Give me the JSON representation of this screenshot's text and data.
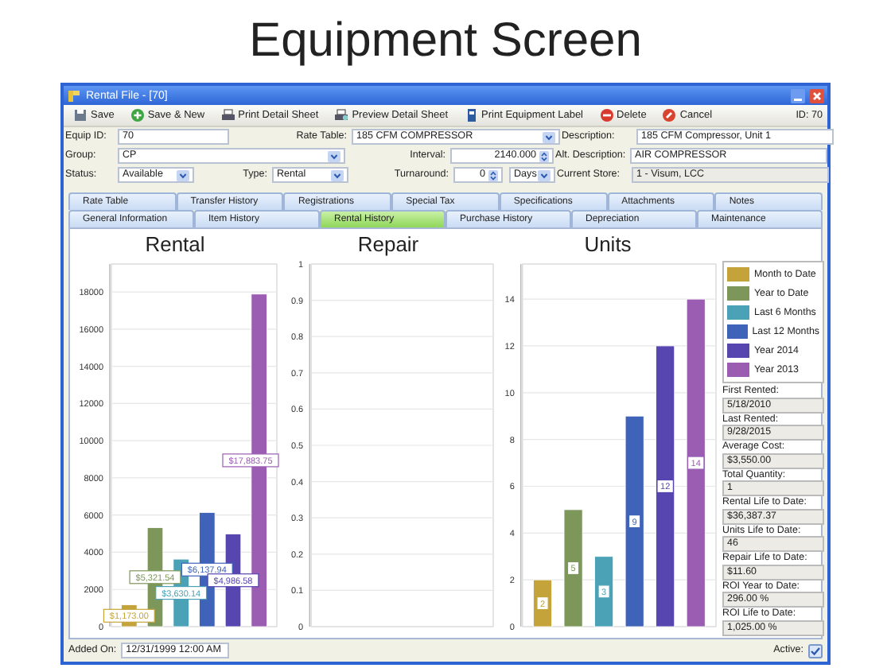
{
  "headline": "Equipment Screen",
  "window": {
    "title": "Rental File - [70]",
    "id_label": "ID: 70"
  },
  "toolbar": [
    {
      "label": "Save",
      "kind": "save"
    },
    {
      "label": "Save & New",
      "kind": "add"
    },
    {
      "label": "Print Detail Sheet",
      "kind": "print"
    },
    {
      "label": "Preview Detail Sheet",
      "kind": "preview"
    },
    {
      "label": "Print Equipment Label",
      "kind": "label"
    },
    {
      "label": "Delete",
      "kind": "delete"
    },
    {
      "label": "Cancel",
      "kind": "cancel"
    }
  ],
  "form": {
    "fields": [
      {
        "label": "Equip ID:",
        "value": "70",
        "kind": "text"
      },
      {
        "label": "Rate Table:",
        "value": "185 CFM COMPRESSOR",
        "kind": "select"
      },
      {
        "label": "Description:",
        "value": "185 CFM Compressor, Unit 1",
        "kind": "text"
      },
      {
        "label": "Group:",
        "value": "CP",
        "kind": "select"
      },
      {
        "label": "Interval:",
        "value": "2140.000",
        "kind": "spin"
      },
      {
        "label": "Alt. Description:",
        "value": "AIR COMPRESSOR",
        "kind": "text"
      },
      {
        "label": "Status:",
        "value": "Available",
        "kind": "select"
      },
      {
        "label": "Type:",
        "value": "Rental",
        "kind": "select"
      },
      {
        "label": "Turnaround:",
        "value": "0",
        "kind": "spin"
      },
      {
        "value": "Days",
        "kind": "select"
      },
      {
        "label": "Current Store:",
        "value": "1 - Visum, LCC",
        "kind": "readonly"
      }
    ]
  },
  "tabs": {
    "back_tabs": [
      {
        "label": "Rate Table",
        "selected": false
      },
      {
        "label": "Transfer History",
        "selected": false
      },
      {
        "label": "Registrations",
        "selected": false
      },
      {
        "label": "Special Tax",
        "selected": false
      },
      {
        "label": "Specifications",
        "selected": false
      },
      {
        "label": "Attachments",
        "selected": false
      },
      {
        "label": "Notes",
        "selected": false
      }
    ],
    "front_tabs": [
      {
        "label": "General Information",
        "selected": false
      },
      {
        "label": "Item History",
        "selected": false
      },
      {
        "label": "Rental History",
        "selected": true
      },
      {
        "label": "Purchase History",
        "selected": false
      },
      {
        "label": "Depreciation",
        "selected": false
      },
      {
        "label": "Maintenance",
        "selected": false
      }
    ]
  },
  "legend": [
    {
      "label": "Month to Date",
      "color": "#c4a43a"
    },
    {
      "label": "Year to Date",
      "color": "#7d975a"
    },
    {
      "label": "Last 6 Months",
      "color": "#4ba2b6"
    },
    {
      "label": "Last 12 Months",
      "color": "#3f63b8"
    },
    {
      "label": "Year 2014",
      "color": "#5745b0"
    },
    {
      "label": "Year 2013",
      "color": "#9a5db2"
    }
  ],
  "charts": [
    {
      "chart_data": {
        "type": "bar",
        "grid": true,
        "title": "Rental",
        "values": [
          1173.0,
          5321.54,
          3630.14,
          6137.94,
          4986.58,
          17883.75
        ],
        "ylim": [
          0,
          19500
        ],
        "yticks": [
          0,
          2000,
          4000,
          6000,
          8000,
          10000,
          12000,
          14000,
          16000,
          18000
        ],
        "value_labels": [
          "$1,173.00",
          "$5,321.54",
          "$3,630.14",
          "$6,137.94",
          "$4,986.58",
          "$17,883.75"
        ]
      }
    },
    {
      "title": "Repair",
      "axis_labels": [
        "1",
        "0.9",
        "0.8",
        "0.7",
        "0.6",
        "0.5",
        "0.4",
        "0.3",
        "0.2",
        "0.1",
        "0"
      ]
    },
    {
      "chart_data": {
        "type": "bar",
        "grid": true,
        "title": "Units",
        "values": [
          2,
          5,
          3,
          9,
          12,
          14
        ],
        "ylim": [
          0,
          15.5
        ],
        "yticks": [
          0,
          2,
          4,
          6,
          8,
          10,
          12,
          14
        ],
        "value_labels": [
          "2",
          "5",
          "3",
          "9",
          "12",
          "14"
        ]
      }
    }
  ],
  "stats": [
    {
      "label": "First Rented:",
      "value": "5/18/2010"
    },
    {
      "label": "Last Rented:",
      "value": "9/28/2015"
    },
    {
      "label": "Average Cost:",
      "value": "$3,550.00"
    },
    {
      "label": "Total Quantity:",
      "value": "1"
    },
    {
      "label": "Rental Life to Date:",
      "value": "$36,387.37"
    },
    {
      "label": "Units Life to Date:",
      "value": "46"
    },
    {
      "label": "Repair Life to Date:",
      "value": "$11.60"
    },
    {
      "label": "ROI Year to Date:",
      "value": "296.00 %"
    },
    {
      "label": "ROI Life to Date:",
      "value": "1,025.00 %"
    }
  ],
  "footer": {
    "added_on": {
      "label": "Added On:",
      "value": "12/31/1999 12:00 AM"
    },
    "active": {
      "label": "Active:",
      "checked": true
    }
  }
}
